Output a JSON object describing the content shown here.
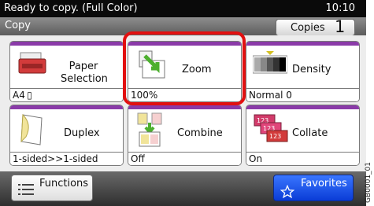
{
  "status": {
    "message": "Ready to copy. (Full Color)",
    "time": "10:10"
  },
  "title": {
    "mode": "Copy",
    "copies_label": "Copies",
    "copies_value": "1"
  },
  "tiles": {
    "paper": {
      "label": "Paper\nSelection",
      "value": "A4 ▯"
    },
    "zoom": {
      "label": "Zoom",
      "value": "100%"
    },
    "density": {
      "label": "Density",
      "value": "Normal 0"
    },
    "duplex": {
      "label": "Duplex",
      "value": "1-sided>>1-sided"
    },
    "combine": {
      "label": "Combine",
      "value": "Off"
    },
    "collate": {
      "label": "Collate",
      "value": "On"
    }
  },
  "bottom": {
    "functions_label": "Functions",
    "favorites_label": "Favorites"
  },
  "figure_code": "GB0001_01",
  "colors": {
    "accent_band": "#8a3aa8",
    "selection": "#e21010",
    "favorites": "#1d55f0",
    "arrow_green": "#4caf2e"
  }
}
